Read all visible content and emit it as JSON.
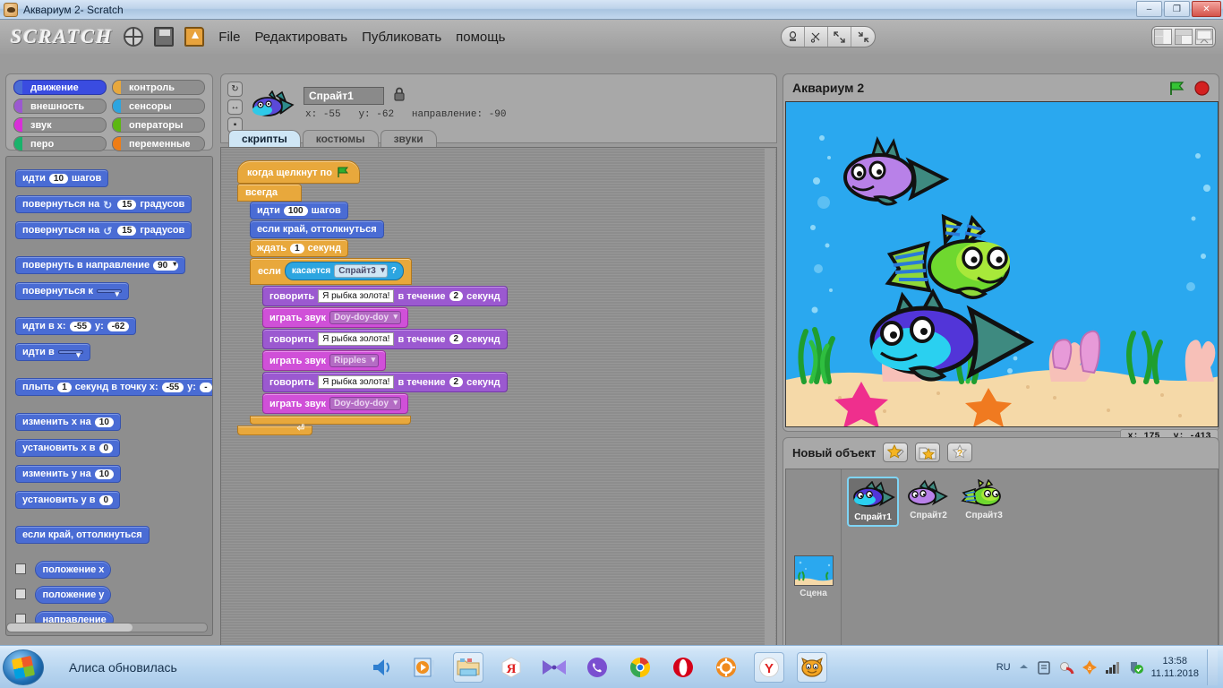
{
  "window": {
    "title": "Аквариум 2- Scratch",
    "minimize": "–",
    "maximize": "❐",
    "close": "✕"
  },
  "menubar": {
    "logo": "SCRATCH",
    "icons": [
      "globe-icon",
      "save-icon",
      "open-project-icon"
    ],
    "items": [
      "File",
      "Редактировать",
      "Публиковать",
      "помощь"
    ],
    "tools": [
      "stamp-tool",
      "scissors-tool",
      "grow-tool",
      "shrink-tool"
    ],
    "view_modes": [
      "small-stage-layout",
      "normal-layout",
      "presentation-layout"
    ],
    "view_selected": 1
  },
  "palette": {
    "categories": [
      {
        "label": "движение",
        "cls": "c-motion",
        "selected": true
      },
      {
        "label": "контроль",
        "cls": "c-control",
        "selected": false
      },
      {
        "label": "внешность",
        "cls": "c-looks",
        "selected": false
      },
      {
        "label": "сенсоры",
        "cls": "c-sensing",
        "selected": false
      },
      {
        "label": "звук",
        "cls": "c-sound",
        "selected": false
      },
      {
        "label": "операторы",
        "cls": "c-operators",
        "selected": false
      },
      {
        "label": "перо",
        "cls": "c-pen",
        "selected": false
      },
      {
        "label": "переменные",
        "cls": "c-variables",
        "selected": false
      }
    ],
    "blocks": {
      "move_label": "идти",
      "move_value": "10",
      "move_suffix": "шагов",
      "turn_cw_label": "повернуться на",
      "turn_cw_value": "15",
      "turn_cw_suffix": "градусов",
      "turn_ccw_label": "повернуться на",
      "turn_ccw_value": "15",
      "turn_ccw_suffix": "градусов",
      "point_dir_label": "повернуть в направление",
      "point_dir_value": "90",
      "point_to_label": "повернуться к",
      "point_to_value": "",
      "goto_xy_label": "идти в x:",
      "goto_x": "-55",
      "goto_y_label": "y:",
      "goto_y": "-62",
      "goto_label": "идти в",
      "goto_value": "",
      "glide_label": "плыть",
      "glide_secs": "1",
      "glide_mid": "секунд в точку x:",
      "glide_x": "-55",
      "glide_y_label": "y:",
      "glide_y": "-",
      "change_x_label": "изменить x на",
      "change_x_value": "10",
      "set_x_label": "установить x в",
      "set_x_value": "0",
      "change_y_label": "изменить y на",
      "change_y_value": "10",
      "set_y_label": "установить y в",
      "set_y_value": "0",
      "bounce_label": "если край, оттолкнуться",
      "watch_x": "положение x",
      "watch_y": "положение y",
      "watch_dir": "направление"
    }
  },
  "sprite_header": {
    "rotation_buttons": [
      "rotate-all-around",
      "rotate-left-right",
      "rotate-none"
    ],
    "name": "Спрайт1",
    "lock_icon": "lock-icon",
    "x_label": "x:",
    "x_value": "-55",
    "y_label": "y:",
    "y_value": "-62",
    "dir_label": "направление:",
    "dir_value": "-90",
    "tabs": [
      {
        "label": "скрипты",
        "selected": true
      },
      {
        "label": "костюмы",
        "selected": false
      },
      {
        "label": "звуки",
        "selected": false
      }
    ]
  },
  "script": {
    "hat": "когда щелкнут по",
    "hat_icon": "green-flag-icon",
    "forever": "всегда",
    "move_label": "идти",
    "move_value": "100",
    "move_suffix": "шагов",
    "bounce": "если край, оттолкнуться",
    "wait_label": "ждать",
    "wait_value": "1",
    "wait_suffix": "секунд",
    "if_label": "если",
    "touching_label": "касается",
    "touching_target": "Спрайт3",
    "touching_q": "?",
    "say_label": "говорить",
    "say_text": "Я рыбка золота!",
    "say_mid": "в течение",
    "say_secs": "2",
    "say_suffix": "секунд",
    "sound_label": "играть звук",
    "sound_1": "Doy-doy-doy",
    "sound_2": "Ripples",
    "sound_3": "Doy-doy-doy"
  },
  "stage": {
    "title": "Аквариум 2",
    "green_flag": "green-flag-icon",
    "stop_button": "stop-icon",
    "mouse_x_label": "x:",
    "mouse_x": "175",
    "mouse_y_label": "y:",
    "mouse_y": "-413"
  },
  "sprite_list": {
    "new_object_label": "Новый объект",
    "buttons": [
      "paint-new-sprite",
      "choose-new-sprite",
      "random-sprite"
    ],
    "stage_label": "Сцена",
    "sprites": [
      {
        "name": "Спрайт1",
        "selected": true
      },
      {
        "name": "Спрайт2",
        "selected": false
      },
      {
        "name": "Спрайт3",
        "selected": false
      }
    ]
  },
  "taskbar": {
    "start_icon": "windows-start-icon",
    "window_label": "Алиса обновилась",
    "apps": [
      "volume-icon",
      "media-player-icon",
      "file-explorer-icon",
      "yandex-icon",
      "bowtie-icon",
      "viber-icon",
      "chrome-icon",
      "opera-icon",
      "gear-icon",
      "yandex-browser-icon",
      "scratch-cat-icon"
    ],
    "tray_lang": "RU",
    "tray_icons": [
      "show-hidden-icon",
      "clipboard-icon",
      "antivirus-icon",
      "orange-tray-icon",
      "network-icon",
      "security-icon"
    ],
    "time": "13:58",
    "date": "11.11.2018"
  },
  "colors": {
    "motion": "#4a6cd4",
    "control": "#e8a83c",
    "looks": "#9b59d0",
    "sound": "#d050d8",
    "sensing": "#2ca5e0",
    "stage_water": "#2aa8ef"
  }
}
